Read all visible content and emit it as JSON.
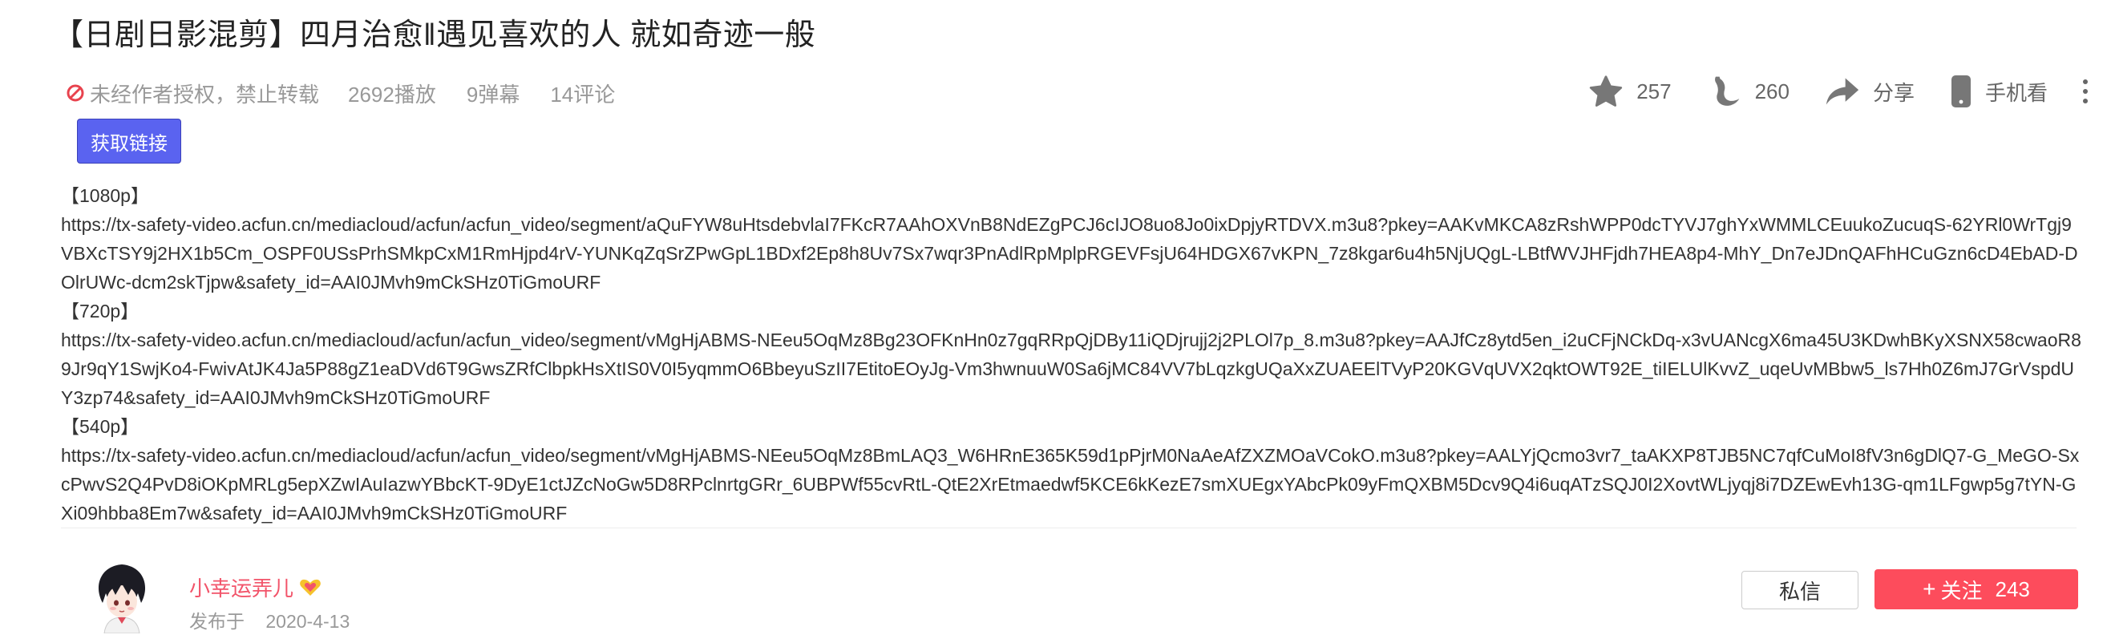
{
  "video": {
    "title": "【日剧日影混剪】四月治愈‖遇见喜欢的人  就如奇迹一般",
    "copyright_notice": "未经作者授权，禁止转载",
    "plays": "2692播放",
    "danmaku": "9弹幕",
    "comments": "14评论"
  },
  "actions": {
    "like_count": "257",
    "banana_count": "260",
    "share_label": "分享",
    "mobile_label": "手机看"
  },
  "get_link_label": "获取链接",
  "stream_links": [
    {
      "quality": "【1080p】",
      "url": "https://tx-safety-video.acfun.cn/mediacloud/acfun/acfun_video/segment/aQuFYW8uHtsdebvlaI7FKcR7AAhOXVnB8NdEZgPCJ6cIJO8uo8Jo0ixDpjyRTDVX.m3u8?pkey=AAKvMKCA8zRshWPP0dcTYVJ7ghYxWMMLCEuukoZucuqS-62YRl0WrTgj9VBXcTSY9j2HX1b5Cm_OSPF0USsPrhSMkpCxM1RmHjpd4rV-YUNKqZqSrZPwGpL1BDxf2Ep8h8Uv7Sx7wqr3PnAdlRpMplpRGEVFsjU64HDGX67vKPN_7z8kgar6u4h5NjUQgL-LBtfWVJHFjdh7HEA8p4-MhY_Dn7eJDnQAFhHCuGzn6cD4EbAD-DOlrUWc-dcm2skTjpw&safety_id=AAI0JMvh9mCkSHz0TiGmoURF"
    },
    {
      "quality": "【720p】",
      "url": "https://tx-safety-video.acfun.cn/mediacloud/acfun/acfun_video/segment/vMgHjABMS-NEeu5OqMz8Bg23OFKnHn0z7gqRRpQjDBy11iQDjrujj2j2PLOl7p_8.m3u8?pkey=AAJfCz8ytd5en_i2uCFjNCkDq-x3vUANcgX6ma45U3KDwhBKyXSNX58cwaoR89Jr9qY1SwjKo4-FwivAtJK4Ja5P88gZ1eaDVd6T9GwsZRfClbpkHsXtIS0V0I5yqmmO6BbeyuSzII7EtitoEOyJg-Vm3hwnuuW0Sa6jMC84VV7bLqzkgUQaXxZUAEElTVyP20KGVqUVX2qktOWT92E_tiIELUlKvvZ_uqeUvMBbw5_ls7Hh0Z6mJ7GrVspdUY3zp74&safety_id=AAI0JMvh9mCkSHz0TiGmoURF"
    },
    {
      "quality": "【540p】",
      "url": "https://tx-safety-video.acfun.cn/mediacloud/acfun/acfun_video/segment/vMgHjABMS-NEeu5OqMz8BmLAQ3_W6HRnE365K59d1pPjrM0NaAeAfZXZMOaVCokO.m3u8?pkey=AALYjQcmo3vr7_taAKXP8TJB5NC7qfCuMoI8fV3n6gDlQ7-G_MeGO-SxcPwvS2Q4PvD8iOKpMRLg5epXZwIAuIazwYBbcKT-9DyE1ctJZcNoGw5D8RPclnrtgGRr_6UBPWf55cvRtL-QtE2XrEtmaedwf5KCE6kKezE7smXUEgxYAbcPk09yFmQXBM5Dcv9Q4i6uqATzSQJ0I2XovtWLjyqj8i7DZEwEvh13G-qm1LFgwp5g7tYN-GXi09hbba8Em7w&safety_id=AAI0JMvh9mCkSHz0TiGmoURF"
    }
  ],
  "uploader": {
    "name": "小幸运弄儿",
    "published_label": "发布于",
    "published_date": "2020-4-13",
    "message_label": "私信",
    "follow_label": "关注",
    "follow_count": "243"
  },
  "icons": {
    "copyright": "no-entry-icon",
    "like": "star-icon",
    "banana": "banana-icon",
    "share": "share-arrow-icon",
    "mobile": "phone-icon",
    "more": "more-vertical-icon",
    "badge": "heart-badge-icon"
  },
  "colors": {
    "accent_pink": "#fd4c5c",
    "link_button": "#5a63f0",
    "warning_red": "#e8434e",
    "icon_gray": "#777777",
    "uploader_name": "#f2546a"
  }
}
